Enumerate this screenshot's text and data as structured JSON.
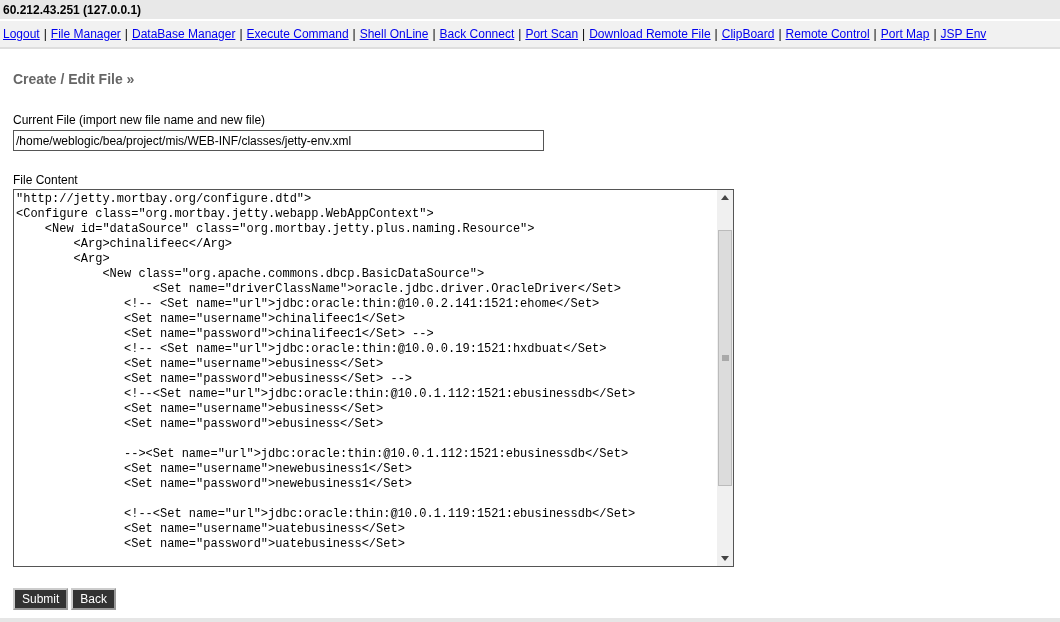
{
  "header": {
    "title": "60.212.43.251 (127.0.0.1)"
  },
  "nav": {
    "links": [
      "Logout",
      "File Manager",
      "DataBase Manager",
      "Execute Command",
      "Shell OnLine",
      "Back Connect",
      "Port Scan",
      "Download Remote File",
      "ClipBoard",
      "Remote Control",
      "Port Map",
      "JSP Env"
    ],
    "separator": "|"
  },
  "heading": "Create / Edit File »",
  "current_file": {
    "label": "Current File (import new file name and new file)",
    "value": "/home/weblogic/bea/project/mis/WEB-INF/classes/jetty-env.xml"
  },
  "file_content": {
    "label": "File Content",
    "blocks": [
      [
        "\"http://jetty.mortbay.org/configure.dtd\">",
        "<Configure class=\"org.mortbay.jetty.webapp.WebAppContext\">",
        "    <New id=\"dataSource\" class=\"org.mortbay.jetty.plus.naming.Resource\">",
        "        <Arg>chinalifeec</Arg>",
        "        <Arg>",
        "            <New class=\"org.apache.commons.dbcp.BasicDataSource\">",
        "                   <Set name=\"driverClassName\">oracle.jdbc.driver.OracleDriver</Set>",
        "               <!-- <Set name=\"url\">jdbc:oracle:thin:@10.0.2.141:1521:ehome</Set>",
        "               <Set name=\"username\">chinalifeec1</Set>",
        "               <Set name=\"password\">chinalifeec1</Set> -->",
        "               <!-- <Set name=\"url\">jdbc:oracle:thin:@10.0.0.19:1521:hxdbuat</Set>",
        "               <Set name=\"username\">ebusiness</Set>",
        "               <Set name=\"password\">ebusiness</Set> -->",
        "               <!--<Set name=\"url\">jdbc:oracle:thin:@10.0.1.112:1521:ebusinessdb</Set>",
        "               <Set name=\"username\">ebusiness</Set>",
        "               <Set name=\"password\">ebusiness</Set>"
      ],
      [
        "               --><Set name=\"url\">jdbc:oracle:thin:@10.0.1.112:1521:ebusinessdb</Set>",
        "               <Set name=\"username\">newebusiness1</Set>",
        "               <Set name=\"password\">newebusiness1</Set>"
      ],
      [
        "               <!--<Set name=\"url\">jdbc:oracle:thin:@10.0.1.119:1521:ebusinessdb</Set>",
        "               <Set name=\"username\">uatebusiness</Set>",
        "               <Set name=\"password\">uatebusiness</Set>"
      ]
    ]
  },
  "buttons": [
    "Submit",
    "Back"
  ]
}
